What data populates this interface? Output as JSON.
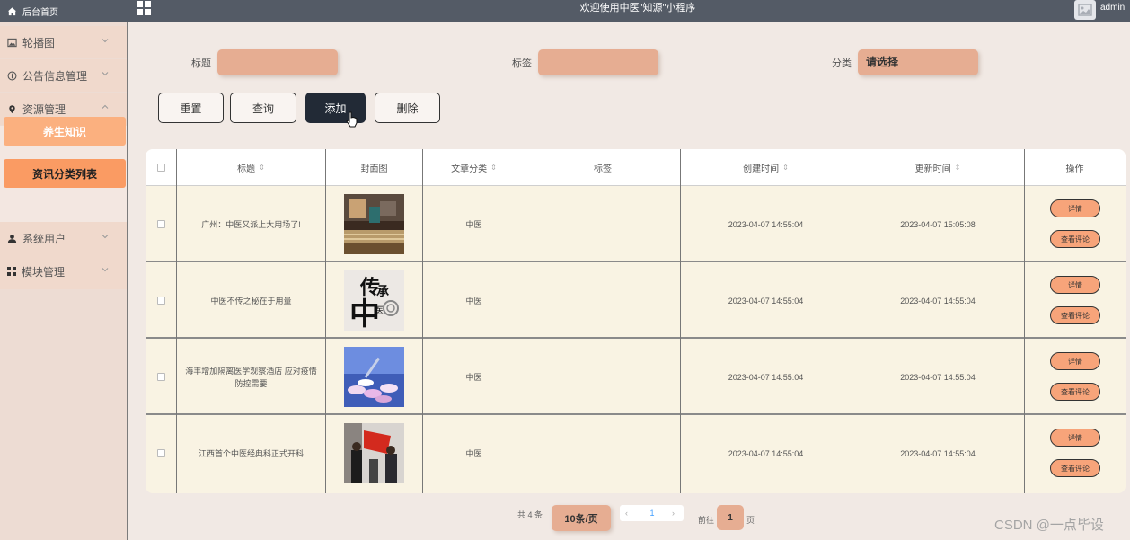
{
  "topbar": {
    "home_label": "后台首页",
    "title": "欢迎使用中医\"知源\"小程序",
    "user": "admin"
  },
  "sidebar": {
    "items": [
      {
        "label": "轮播图",
        "icon": "image-icon"
      },
      {
        "label": "公告信息管理",
        "icon": "info-circle-icon"
      },
      {
        "label": "资源管理",
        "icon": "location-pin-icon"
      },
      {
        "label": "系统用户",
        "icon": "user-icon"
      },
      {
        "label": "模块管理",
        "icon": "grid-icon"
      }
    ],
    "sub_items": [
      "养生知识",
      "资讯分类列表"
    ]
  },
  "filters": {
    "title_label": "标题",
    "tag_label": "标签",
    "category_label": "分类",
    "category_placeholder": "请选择"
  },
  "buttons": {
    "reset": "重置",
    "search": "查询",
    "add": "添加",
    "delete": "删除"
  },
  "table": {
    "headers": [
      "标题",
      "封面图",
      "文章分类",
      "标签",
      "创建时间",
      "更新时间",
      "操作"
    ],
    "rows": [
      {
        "title": "广州：中医又派上大用场了!",
        "category": "中医",
        "tag": "",
        "created": "2023-04-07 14:55:04",
        "updated": "2023-04-07 15:05:08"
      },
      {
        "title": "中医不传之秘在于用量",
        "category": "中医",
        "tag": "",
        "created": "2023-04-07 14:55:04",
        "updated": "2023-04-07 14:55:04"
      },
      {
        "title": "海丰增加隔离医学观察酒店 应对疫情防控需要",
        "category": "中医",
        "tag": "",
        "created": "2023-04-07 14:55:04",
        "updated": "2023-04-07 14:55:04"
      },
      {
        "title": "江西首个中医经典科正式开科",
        "category": "中医",
        "tag": "",
        "created": "2023-04-07 14:55:04",
        "updated": "2023-04-07 14:55:04"
      }
    ],
    "action_detail": "详情",
    "action_comments": "查看评论"
  },
  "pagination": {
    "total": "共 4 条",
    "page_size": "10条/页",
    "current": "1",
    "goto": "前往",
    "goto_value": "1",
    "unit": "页"
  },
  "cover2_text": {
    "a": "传",
    "b": "承",
    "c": "中",
    "d": "医"
  },
  "watermark": "CSDN @一点毕设"
}
